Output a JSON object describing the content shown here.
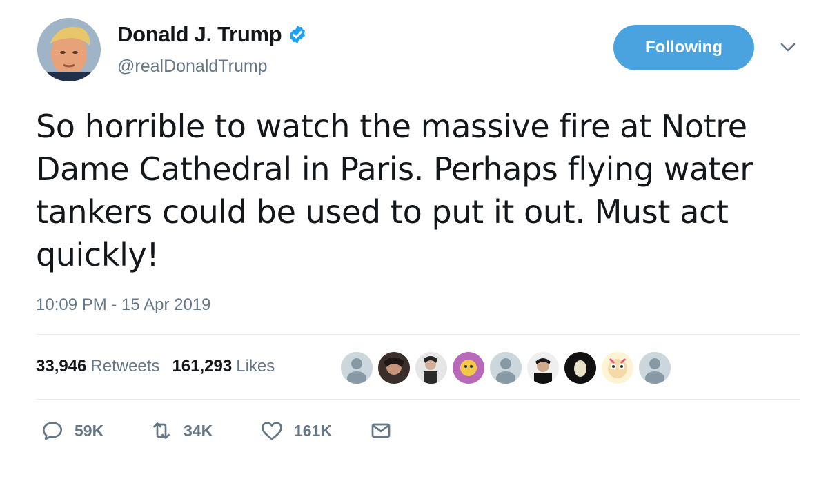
{
  "user": {
    "display_name": "Donald J. Trump",
    "handle": "@realDonaldTrump",
    "verified": true
  },
  "follow_button": {
    "label": "Following"
  },
  "tweet": {
    "text": "So horrible to watch the massive fire at Notre Dame Cathedral in Paris. Perhaps flying water tankers could be used to put it out. Must act quickly!",
    "timestamp": "10:09 PM - 15 Apr 2019"
  },
  "stats": {
    "retweets_count": "33,946",
    "retweets_label": "Retweets",
    "likes_count": "161,293",
    "likes_label": "Likes"
  },
  "actions": {
    "reply_count": "59K",
    "retweet_count": "34K",
    "like_count": "161K"
  },
  "colors": {
    "accent": "#4aa3df",
    "verified": "#1da1f2",
    "muted_text": "#657786",
    "divider": "#e6ecf0"
  },
  "icons": [
    "verified-badge-icon",
    "chevron-down-icon",
    "reply-icon",
    "retweet-icon",
    "like-icon",
    "direct-message-icon"
  ]
}
